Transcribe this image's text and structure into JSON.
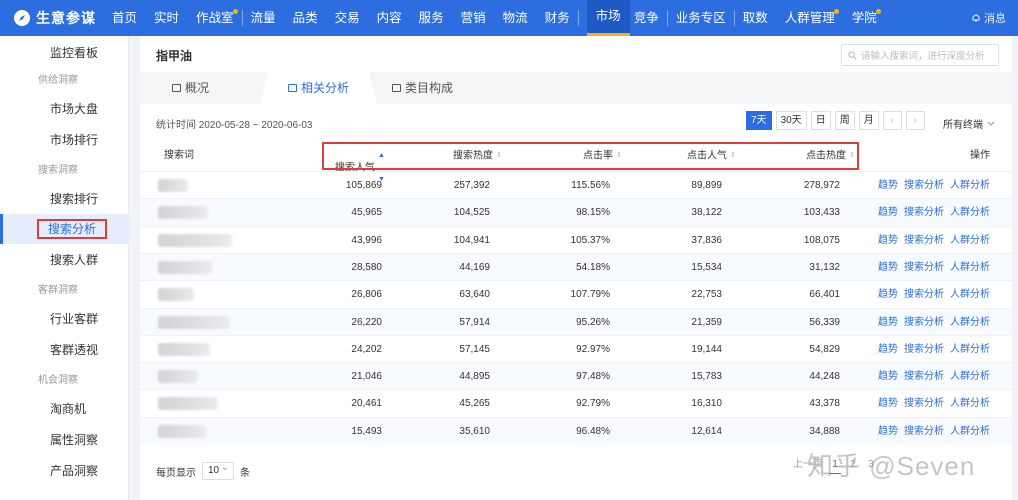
{
  "brand": {
    "name": "生意参谋",
    "logo_icon": "compass-icon"
  },
  "nav": {
    "items": [
      {
        "label": "首页",
        "dot": false,
        "active": false
      },
      {
        "label": "实时",
        "dot": false,
        "active": false
      },
      {
        "label": "作战室",
        "dot": true,
        "active": false
      },
      {
        "label": "流量",
        "dot": false,
        "active": false
      },
      {
        "label": "品类",
        "dot": false,
        "active": false
      },
      {
        "label": "交易",
        "dot": false,
        "active": false
      },
      {
        "label": "内容",
        "dot": false,
        "active": false
      },
      {
        "label": "服务",
        "dot": false,
        "active": false
      },
      {
        "label": "营销",
        "dot": false,
        "active": false
      },
      {
        "label": "物流",
        "dot": false,
        "active": false
      },
      {
        "label": "财务",
        "dot": false,
        "active": false
      },
      {
        "label": "市场",
        "dot": false,
        "active": true
      },
      {
        "label": "竞争",
        "dot": false,
        "active": false
      },
      {
        "label": "业务专区",
        "dot": false,
        "active": false
      },
      {
        "label": "取数",
        "dot": false,
        "active": false
      },
      {
        "label": "人群管理",
        "dot": true,
        "active": false
      },
      {
        "label": "学院",
        "dot": true,
        "active": false
      }
    ],
    "message_label": "消息"
  },
  "sidebar": {
    "items": [
      {
        "type": "item",
        "label": "监控看板"
      },
      {
        "type": "group",
        "label": "供给洞察"
      },
      {
        "type": "item",
        "label": "市场大盘"
      },
      {
        "type": "item",
        "label": "市场排行"
      },
      {
        "type": "group",
        "label": "搜索洞察"
      },
      {
        "type": "item",
        "label": "搜索排行"
      },
      {
        "type": "item",
        "label": "搜索分析",
        "active": true
      },
      {
        "type": "item",
        "label": "搜索人群"
      },
      {
        "type": "group",
        "label": "客群洞察"
      },
      {
        "type": "item",
        "label": "行业客群"
      },
      {
        "type": "item",
        "label": "客群透视"
      },
      {
        "type": "group",
        "label": "机会洞察"
      },
      {
        "type": "item",
        "label": "淘商机"
      },
      {
        "type": "item",
        "label": "属性洞察"
      },
      {
        "type": "item",
        "label": "产品洞察"
      }
    ]
  },
  "main": {
    "keyword_title": "指甲油",
    "search_placeholder": "请输入搜索词，进行深度分析",
    "tabs": [
      {
        "label": "概况",
        "active": false
      },
      {
        "label": "相关分析",
        "active": true
      },
      {
        "label": "类目构成",
        "active": false
      }
    ],
    "date_label": "统计时间 2020-05-28 ~ 2020-06-03",
    "ranges": [
      "7天",
      "30天",
      "日",
      "周",
      "月"
    ],
    "active_range": "7天",
    "prev_icon": "chevron-left-icon",
    "next_icon": "chevron-right-icon",
    "terminal_label": "所有终端"
  },
  "table": {
    "columns": {
      "keyword": "搜索词",
      "search_popularity": "搜索人气",
      "search_heat": "搜索热度",
      "ctr": "点击率",
      "click_popularity": "点击人气",
      "click_heat": "点击热度",
      "actions": "操作"
    },
    "sorted_column": "search_popularity",
    "rows": [
      {
        "search_popularity": "105,869",
        "search_heat": "257,392",
        "ctr": "115.56%",
        "click_popularity": "89,899",
        "click_heat": "278,972"
      },
      {
        "search_popularity": "45,965",
        "search_heat": "104,525",
        "ctr": "98.15%",
        "click_popularity": "38,122",
        "click_heat": "103,433"
      },
      {
        "search_popularity": "43,996",
        "search_heat": "104,941",
        "ctr": "105.37%",
        "click_popularity": "37,836",
        "click_heat": "108,075"
      },
      {
        "search_popularity": "28,580",
        "search_heat": "44,169",
        "ctr": "54.18%",
        "click_popularity": "15,534",
        "click_heat": "31,132"
      },
      {
        "search_popularity": "26,806",
        "search_heat": "63,640",
        "ctr": "107.79%",
        "click_popularity": "22,753",
        "click_heat": "66,401"
      },
      {
        "search_popularity": "26,220",
        "search_heat": "57,914",
        "ctr": "95.26%",
        "click_popularity": "21,359",
        "click_heat": "56,339"
      },
      {
        "search_popularity": "24,202",
        "search_heat": "57,145",
        "ctr": "92.97%",
        "click_popularity": "19,144",
        "click_heat": "54,829"
      },
      {
        "search_popularity": "21,046",
        "search_heat": "44,895",
        "ctr": "97.48%",
        "click_popularity": "15,783",
        "click_heat": "44,248"
      },
      {
        "search_popularity": "20,461",
        "search_heat": "45,265",
        "ctr": "92.79%",
        "click_popularity": "16,310",
        "click_heat": "43,378"
      },
      {
        "search_popularity": "15,493",
        "search_heat": "35,610",
        "ctr": "96.48%",
        "click_popularity": "12,614",
        "click_heat": "34,888"
      }
    ],
    "row_actions": [
      "趋势",
      "搜索分析",
      "人群分析"
    ]
  },
  "pagination": {
    "prefix": "每页显示",
    "page_size": "10",
    "suffix": "条",
    "prev_label": "上一页",
    "pages": [
      "1",
      "2",
      "3"
    ],
    "current_page": "1"
  },
  "watermark": "知乎 @Seven",
  "colors": {
    "primary": "#2c6de0",
    "highlight": "#e03a3a",
    "nav_dot": "#ffb300"
  }
}
